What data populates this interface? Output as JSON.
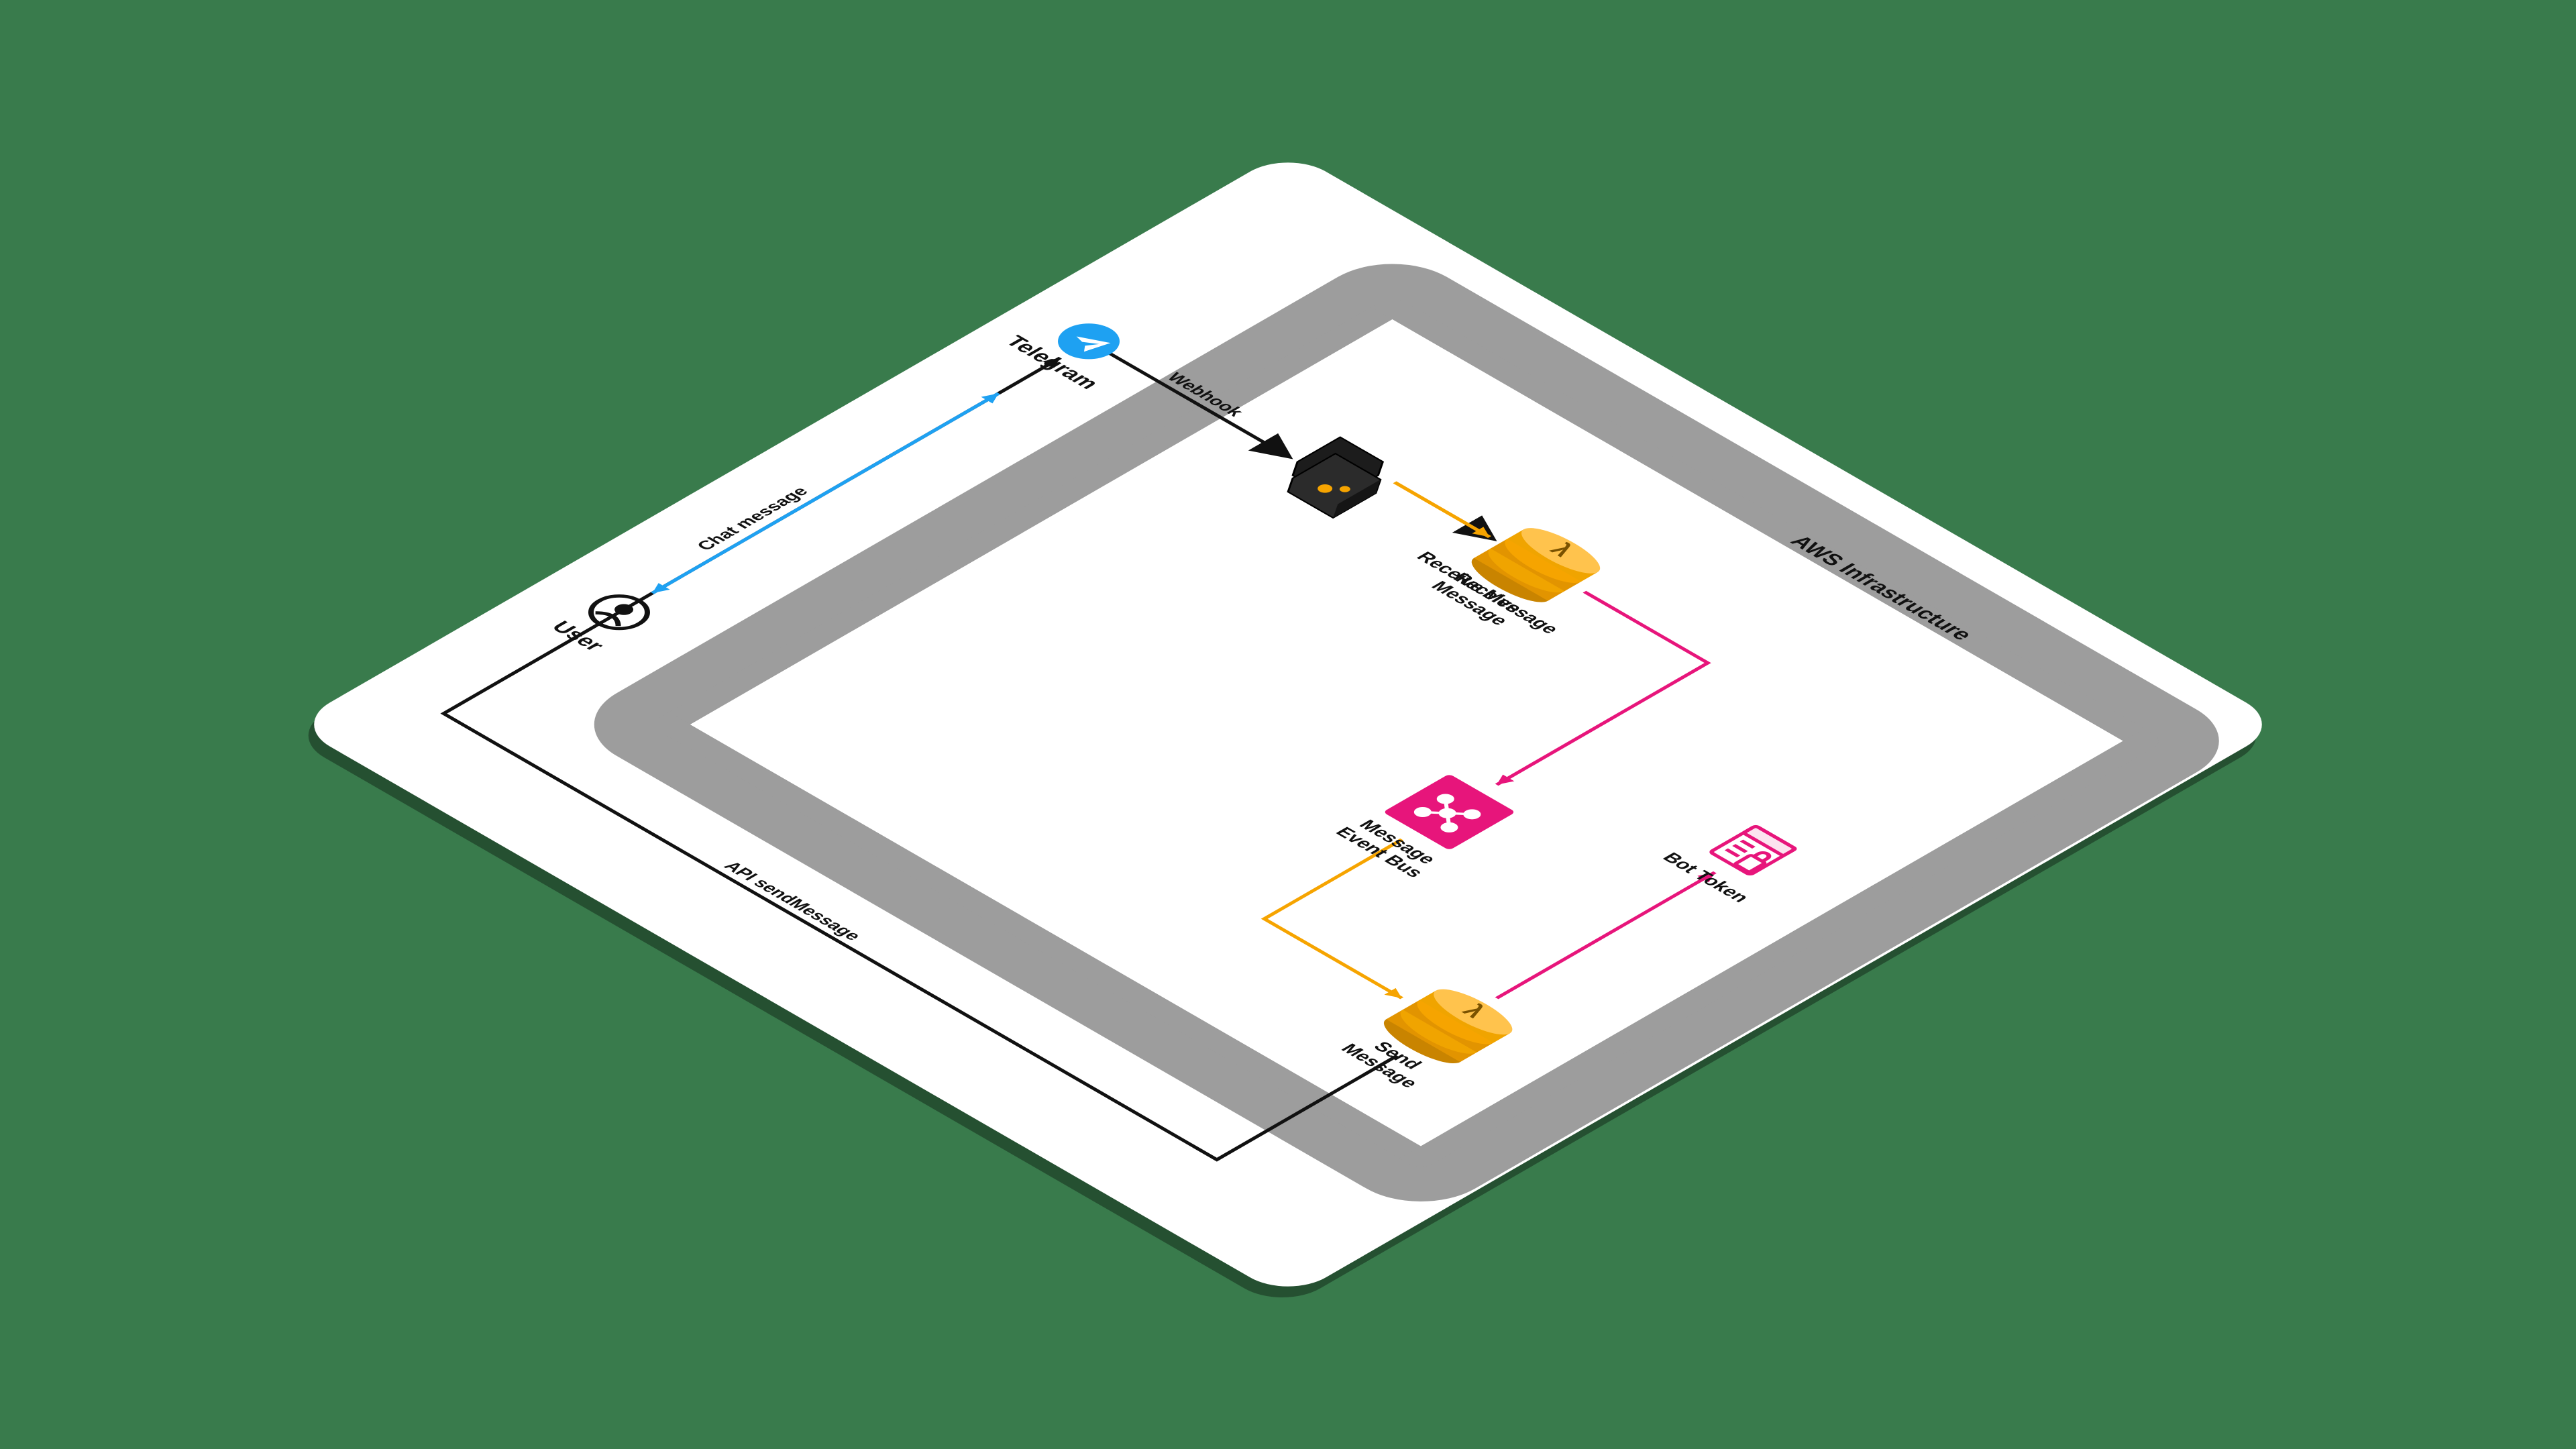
{
  "container_label": "AWS Infrastructure",
  "nodes": {
    "telegram": "Telegram",
    "user": "User",
    "receive": "Receive\nMessage",
    "send": "Send\nMessage",
    "eventbus": "Message\nEvent Bus",
    "bottoken": "Bot Token"
  },
  "edges": {
    "webhook": "Webhook",
    "api_send": "API sendMessage",
    "chat": "Chat message"
  },
  "colors": {
    "bg": "#397b4c",
    "panel": "#ffffff",
    "frame": "#9d9d9d",
    "aws_orange": "#f6a400",
    "aws_pink": "#e7157b",
    "telegram": "#1ea1f2",
    "black": "#111111"
  }
}
